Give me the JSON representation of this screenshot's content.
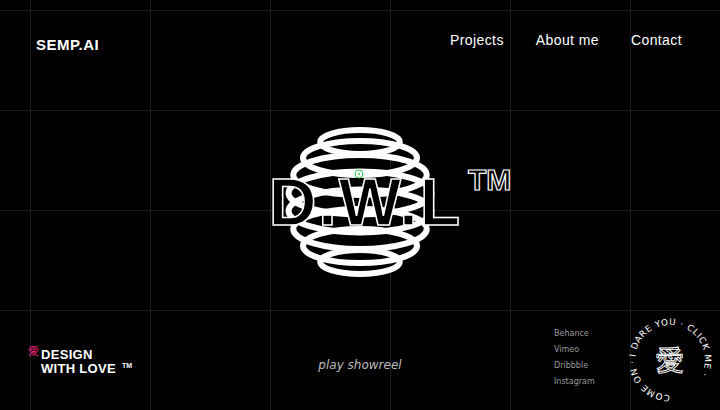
{
  "header": {
    "logo": "SEMP.AI",
    "nav": [
      {
        "label": "Projects"
      },
      {
        "label": "About me"
      },
      {
        "label": "Contact"
      }
    ]
  },
  "hero": {
    "title": "D.W.L",
    "mark": "TM"
  },
  "tagline": {
    "glyph": "愛",
    "lines": [
      "DESIGN",
      "WITH LOVE"
    ],
    "mark": "TM"
  },
  "showreel": "play showreel",
  "socials": [
    "Behance",
    "Vimeo",
    "Dribbble",
    "Instagram"
  ],
  "badge": {
    "ring": "COME ON · I DARE YOU · CLICK ME ·",
    "glyph": "愛"
  }
}
